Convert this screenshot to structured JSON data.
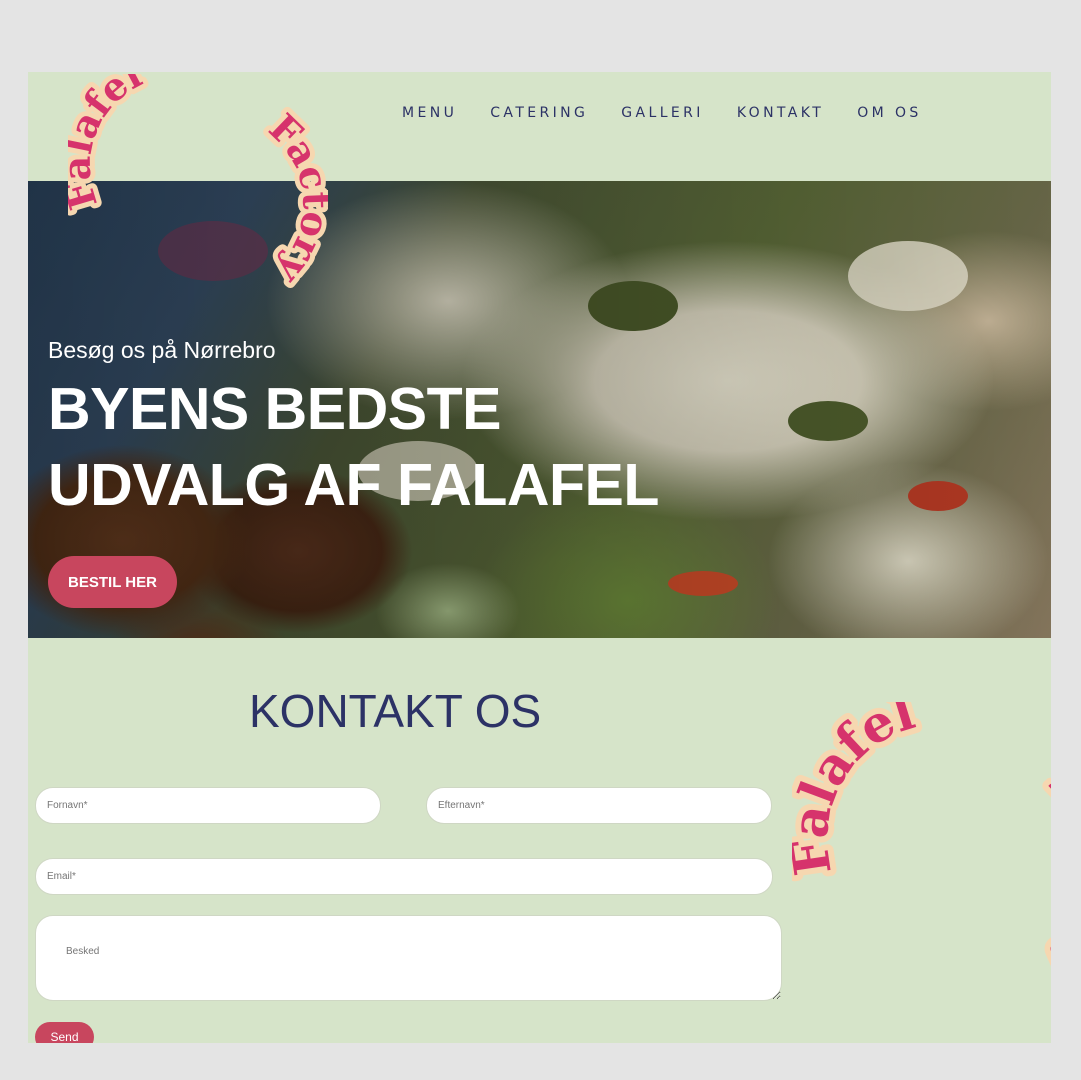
{
  "brand": {
    "logo_line1": "Falafel",
    "logo_line2": "Factory"
  },
  "nav": {
    "items": [
      "MENU",
      "CATERING",
      "GALLERI",
      "KONTAKT",
      "OM OS"
    ]
  },
  "hero": {
    "subtitle": "Besøg os på Nørrebro",
    "title_line1": "BYENS BEDSTE",
    "title_line2": "UDVALG AF FALAFEL",
    "cta_label": "BESTIL HER"
  },
  "contact": {
    "title": "KONTAKT OS",
    "first_name_placeholder": "Fornavn*",
    "last_name_placeholder": "Efternavn*",
    "email_placeholder": "Email*",
    "message_placeholder": "Besked",
    "send_label": "Send"
  },
  "colors": {
    "page_background": "#d6e4c9",
    "nav_text": "#2c3266",
    "accent": "#c8465e",
    "logo_pink": "#d6336c",
    "logo_outline": "#f6d7b0"
  }
}
